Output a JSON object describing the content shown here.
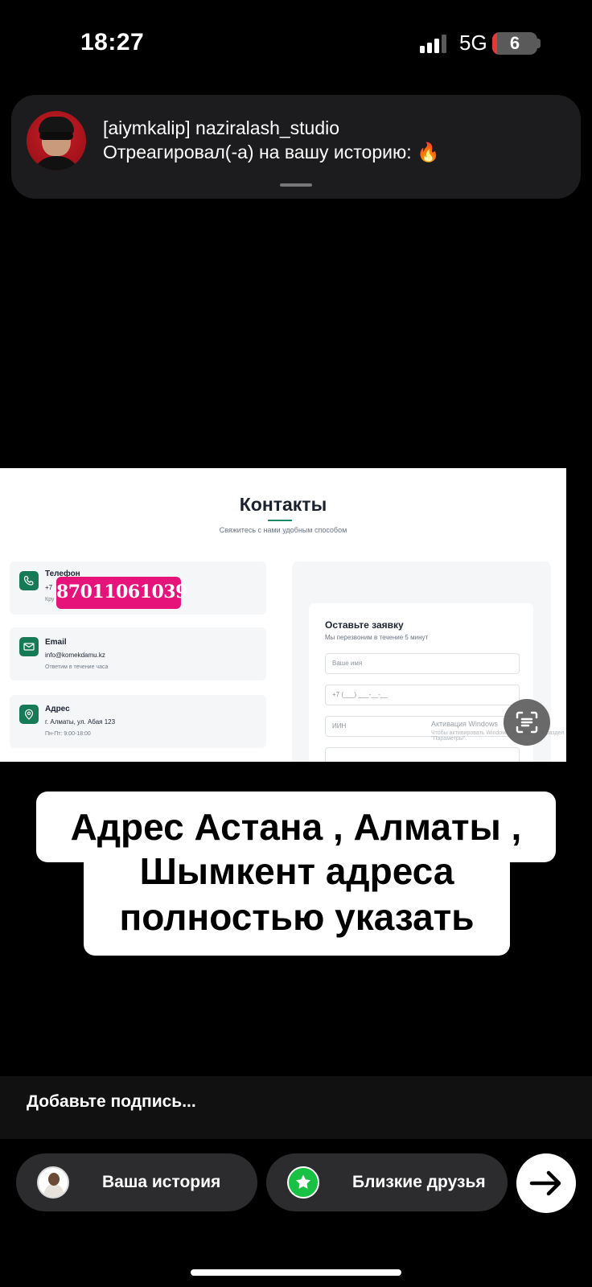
{
  "status_bar": {
    "time": "18:27",
    "network": "5G",
    "battery": "6",
    "battery_level": 0.06
  },
  "notification": {
    "title": "[aiymkalip] naziralash_studio",
    "text": "Отреагировал(-а) на вашу историю: 🔥"
  },
  "screenshot": {
    "heading": "Контакты",
    "subheading": "Свяжитесь с нами удобным способом",
    "cards": [
      {
        "title": "Телефон",
        "value": "+7",
        "note": "Кру"
      },
      {
        "title": "Email",
        "value": "info@komekdamu.kz",
        "note": "Ответим в течение часа"
      },
      {
        "title": "Адрес",
        "value": "г. Алматы, ул. Абая 123",
        "note": "Пн-Пт: 9:00-18:00"
      }
    ],
    "form": {
      "title": "Оставьте заявку",
      "subtitle": "Мы перезвоним в течение 5 минут",
      "fields": [
        "Ваше имя",
        "+7 (___) ___-__-__",
        "ИИН",
        ""
      ]
    },
    "watermark": "Активация Windows",
    "watermark_sub": "Чтобы активировать Windows, перейдите в раздел \"Параметры\"."
  },
  "phone_sticker": "87011061039",
  "caption_sticker": {
    "line1": "Адрес Астана , Алматы ,",
    "line2": "Шымкент адреса",
    "line3": "полностью указать"
  },
  "caption_placeholder": "Добавьте подпись...",
  "share": {
    "your_story": "Ваша история",
    "close_friends": "Близкие друзья"
  },
  "colors": {
    "sticker_pink": "#e6137a",
    "close_friends_green": "#18c043",
    "site_green": "#167a57"
  },
  "icons": [
    "signal-icon",
    "battery-icon",
    "phone-icon",
    "mail-icon",
    "location-icon",
    "lens-icon",
    "star-icon",
    "arrow-right-icon"
  ]
}
